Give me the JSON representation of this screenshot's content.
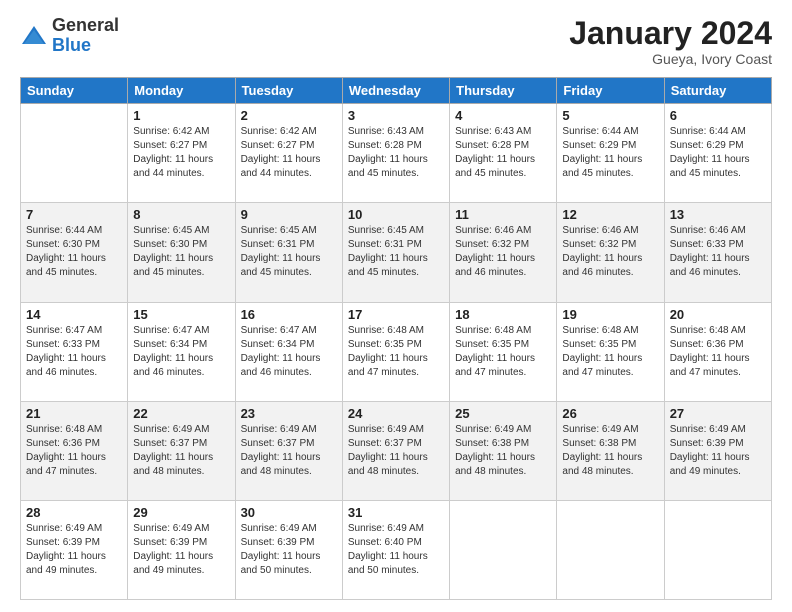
{
  "logo": {
    "general": "General",
    "blue": "Blue"
  },
  "title": {
    "month_year": "January 2024",
    "location": "Gueya, Ivory Coast"
  },
  "days_of_week": [
    "Sunday",
    "Monday",
    "Tuesday",
    "Wednesday",
    "Thursday",
    "Friday",
    "Saturday"
  ],
  "weeks": [
    [
      {
        "day": "",
        "info": ""
      },
      {
        "day": "1",
        "info": "Sunrise: 6:42 AM\nSunset: 6:27 PM\nDaylight: 11 hours\nand 44 minutes."
      },
      {
        "day": "2",
        "info": "Sunrise: 6:42 AM\nSunset: 6:27 PM\nDaylight: 11 hours\nand 44 minutes."
      },
      {
        "day": "3",
        "info": "Sunrise: 6:43 AM\nSunset: 6:28 PM\nDaylight: 11 hours\nand 45 minutes."
      },
      {
        "day": "4",
        "info": "Sunrise: 6:43 AM\nSunset: 6:28 PM\nDaylight: 11 hours\nand 45 minutes."
      },
      {
        "day": "5",
        "info": "Sunrise: 6:44 AM\nSunset: 6:29 PM\nDaylight: 11 hours\nand 45 minutes."
      },
      {
        "day": "6",
        "info": "Sunrise: 6:44 AM\nSunset: 6:29 PM\nDaylight: 11 hours\nand 45 minutes."
      }
    ],
    [
      {
        "day": "7",
        "info": "Sunrise: 6:44 AM\nSunset: 6:30 PM\nDaylight: 11 hours\nand 45 minutes."
      },
      {
        "day": "8",
        "info": "Sunrise: 6:45 AM\nSunset: 6:30 PM\nDaylight: 11 hours\nand 45 minutes."
      },
      {
        "day": "9",
        "info": "Sunrise: 6:45 AM\nSunset: 6:31 PM\nDaylight: 11 hours\nand 45 minutes."
      },
      {
        "day": "10",
        "info": "Sunrise: 6:45 AM\nSunset: 6:31 PM\nDaylight: 11 hours\nand 45 minutes."
      },
      {
        "day": "11",
        "info": "Sunrise: 6:46 AM\nSunset: 6:32 PM\nDaylight: 11 hours\nand 46 minutes."
      },
      {
        "day": "12",
        "info": "Sunrise: 6:46 AM\nSunset: 6:32 PM\nDaylight: 11 hours\nand 46 minutes."
      },
      {
        "day": "13",
        "info": "Sunrise: 6:46 AM\nSunset: 6:33 PM\nDaylight: 11 hours\nand 46 minutes."
      }
    ],
    [
      {
        "day": "14",
        "info": "Sunrise: 6:47 AM\nSunset: 6:33 PM\nDaylight: 11 hours\nand 46 minutes."
      },
      {
        "day": "15",
        "info": "Sunrise: 6:47 AM\nSunset: 6:34 PM\nDaylight: 11 hours\nand 46 minutes."
      },
      {
        "day": "16",
        "info": "Sunrise: 6:47 AM\nSunset: 6:34 PM\nDaylight: 11 hours\nand 46 minutes."
      },
      {
        "day": "17",
        "info": "Sunrise: 6:48 AM\nSunset: 6:35 PM\nDaylight: 11 hours\nand 47 minutes."
      },
      {
        "day": "18",
        "info": "Sunrise: 6:48 AM\nSunset: 6:35 PM\nDaylight: 11 hours\nand 47 minutes."
      },
      {
        "day": "19",
        "info": "Sunrise: 6:48 AM\nSunset: 6:35 PM\nDaylight: 11 hours\nand 47 minutes."
      },
      {
        "day": "20",
        "info": "Sunrise: 6:48 AM\nSunset: 6:36 PM\nDaylight: 11 hours\nand 47 minutes."
      }
    ],
    [
      {
        "day": "21",
        "info": "Sunrise: 6:48 AM\nSunset: 6:36 PM\nDaylight: 11 hours\nand 47 minutes."
      },
      {
        "day": "22",
        "info": "Sunrise: 6:49 AM\nSunset: 6:37 PM\nDaylight: 11 hours\nand 48 minutes."
      },
      {
        "day": "23",
        "info": "Sunrise: 6:49 AM\nSunset: 6:37 PM\nDaylight: 11 hours\nand 48 minutes."
      },
      {
        "day": "24",
        "info": "Sunrise: 6:49 AM\nSunset: 6:37 PM\nDaylight: 11 hours\nand 48 minutes."
      },
      {
        "day": "25",
        "info": "Sunrise: 6:49 AM\nSunset: 6:38 PM\nDaylight: 11 hours\nand 48 minutes."
      },
      {
        "day": "26",
        "info": "Sunrise: 6:49 AM\nSunset: 6:38 PM\nDaylight: 11 hours\nand 48 minutes."
      },
      {
        "day": "27",
        "info": "Sunrise: 6:49 AM\nSunset: 6:39 PM\nDaylight: 11 hours\nand 49 minutes."
      }
    ],
    [
      {
        "day": "28",
        "info": "Sunrise: 6:49 AM\nSunset: 6:39 PM\nDaylight: 11 hours\nand 49 minutes."
      },
      {
        "day": "29",
        "info": "Sunrise: 6:49 AM\nSunset: 6:39 PM\nDaylight: 11 hours\nand 49 minutes."
      },
      {
        "day": "30",
        "info": "Sunrise: 6:49 AM\nSunset: 6:39 PM\nDaylight: 11 hours\nand 50 minutes."
      },
      {
        "day": "31",
        "info": "Sunrise: 6:49 AM\nSunset: 6:40 PM\nDaylight: 11 hours\nand 50 minutes."
      },
      {
        "day": "",
        "info": ""
      },
      {
        "day": "",
        "info": ""
      },
      {
        "day": "",
        "info": ""
      }
    ]
  ]
}
